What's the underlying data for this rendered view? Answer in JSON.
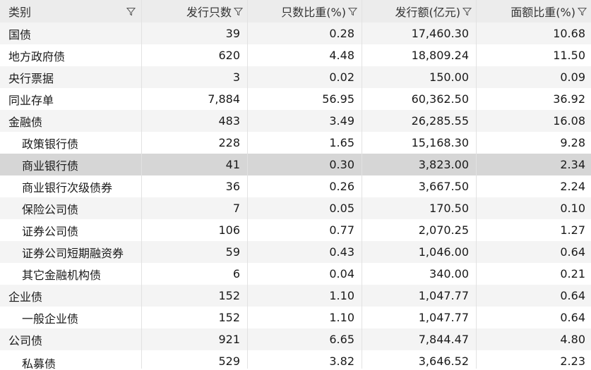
{
  "columns": [
    {
      "label": "类别",
      "icon": "filter-icon"
    },
    {
      "label": "发行只数",
      "icon": "filter-icon"
    },
    {
      "label": "只数比重(%)",
      "icon": "filter-icon"
    },
    {
      "label": "发行额(亿元)",
      "icon": "filter-icon"
    },
    {
      "label": "面额比重(%)",
      "icon": "filter-icon"
    }
  ],
  "rows": [
    {
      "category": "国债",
      "count": "39",
      "count_pct": "0.28",
      "amount": "17,460.30",
      "amount_pct": "10.68",
      "indent": false
    },
    {
      "category": "地方政府债",
      "count": "620",
      "count_pct": "4.48",
      "amount": "18,809.24",
      "amount_pct": "11.50",
      "indent": false
    },
    {
      "category": "央行票据",
      "count": "3",
      "count_pct": "0.02",
      "amount": "150.00",
      "amount_pct": "0.09",
      "indent": false
    },
    {
      "category": "同业存单",
      "count": "7,884",
      "count_pct": "56.95",
      "amount": "60,362.50",
      "amount_pct": "36.92",
      "indent": false
    },
    {
      "category": "金融债",
      "count": "483",
      "count_pct": "3.49",
      "amount": "26,285.55",
      "amount_pct": "16.08",
      "indent": false
    },
    {
      "category": "政策银行债",
      "count": "228",
      "count_pct": "1.65",
      "amount": "15,168.30",
      "amount_pct": "9.28",
      "indent": true
    },
    {
      "category": "商业银行债",
      "count": "41",
      "count_pct": "0.30",
      "amount": "3,823.00",
      "amount_pct": "2.34",
      "indent": true,
      "selected": true
    },
    {
      "category": "商业银行次级债券",
      "count": "36",
      "count_pct": "0.26",
      "amount": "3,667.50",
      "amount_pct": "2.24",
      "indent": true
    },
    {
      "category": "保险公司债",
      "count": "7",
      "count_pct": "0.05",
      "amount": "170.50",
      "amount_pct": "0.10",
      "indent": true
    },
    {
      "category": "证券公司债",
      "count": "106",
      "count_pct": "0.77",
      "amount": "2,070.25",
      "amount_pct": "1.27",
      "indent": true
    },
    {
      "category": "证券公司短期融资券",
      "count": "59",
      "count_pct": "0.43",
      "amount": "1,046.00",
      "amount_pct": "0.64",
      "indent": true
    },
    {
      "category": "其它金融机构债",
      "count": "6",
      "count_pct": "0.04",
      "amount": "340.00",
      "amount_pct": "0.21",
      "indent": true
    },
    {
      "category": "企业债",
      "count": "152",
      "count_pct": "1.10",
      "amount": "1,047.77",
      "amount_pct": "0.64",
      "indent": false
    },
    {
      "category": "一般企业债",
      "count": "152",
      "count_pct": "1.10",
      "amount": "1,047.77",
      "amount_pct": "0.64",
      "indent": true
    },
    {
      "category": "公司债",
      "count": "921",
      "count_pct": "6.65",
      "amount": "7,844.47",
      "amount_pct": "4.80",
      "indent": false
    },
    {
      "category": "私募债",
      "count": "529",
      "count_pct": "3.82",
      "amount": "3,646.52",
      "amount_pct": "2.23",
      "indent": true
    }
  ],
  "colors": {
    "header_bg": "#ececec",
    "stripe": "#f4f4f4",
    "selected_bg": "#d6d6d6"
  }
}
